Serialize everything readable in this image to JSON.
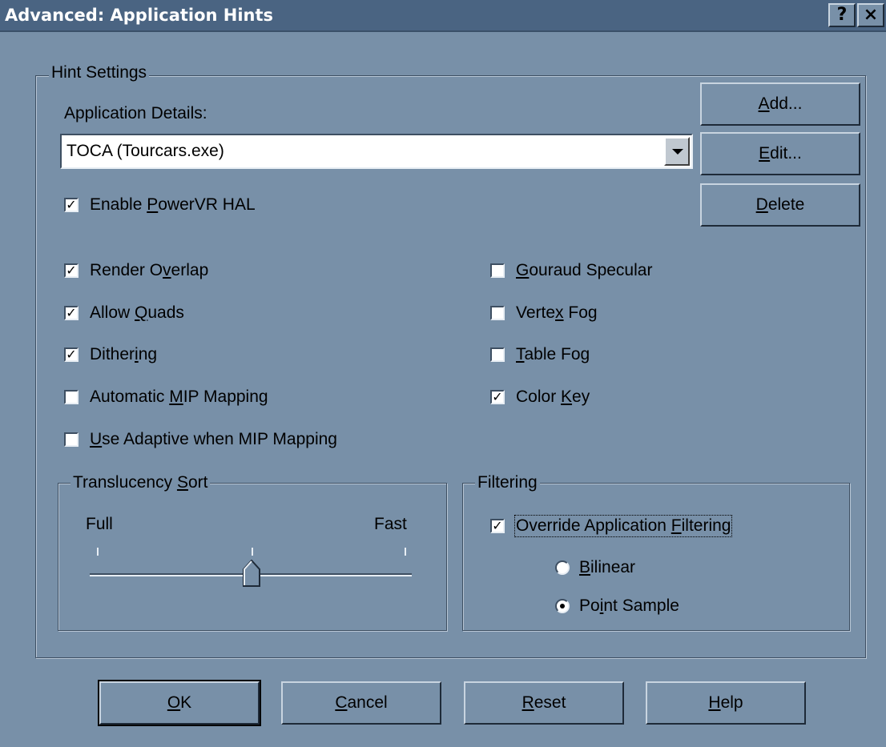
{
  "window": {
    "title": "Advanced: Application Hints",
    "help_button": "?",
    "close_button": "×"
  },
  "hint_settings": {
    "legend": "Hint Settings",
    "app_details_label": "Application Details:",
    "app_selected": "TOCA (Tourcars.exe)",
    "enable_hal": {
      "pre": "Enable ",
      "key": "P",
      "post": "owerVR HAL",
      "checked": true
    }
  },
  "side_buttons": {
    "add": {
      "key": "A",
      "rest": "dd..."
    },
    "edit": {
      "key": "E",
      "rest": "dit..."
    },
    "delete": {
      "key": "D",
      "rest": "elete"
    }
  },
  "options_left": [
    {
      "pre": "Render O",
      "key": "v",
      "post": "erlap",
      "checked": true
    },
    {
      "pre": "Allow ",
      "key": "Q",
      "post": "uads",
      "checked": true
    },
    {
      "pre": "Dither",
      "key": "i",
      "post": "ng",
      "checked": true
    },
    {
      "pre": "Automatic ",
      "key": "M",
      "post": "IP Mapping",
      "checked": false
    },
    {
      "pre": "",
      "key": "U",
      "post": "se Adaptive when MIP Mapping",
      "checked": false
    }
  ],
  "options_right": [
    {
      "pre": "",
      "key": "G",
      "post": "ouraud Specular",
      "checked": false
    },
    {
      "pre": "Verte",
      "key": "x",
      "post": " Fog",
      "checked": false
    },
    {
      "pre": "",
      "key": "T",
      "post": "able Fog",
      "checked": false
    },
    {
      "pre": "Color ",
      "key": "K",
      "post": "ey",
      "checked": true
    }
  ],
  "translucency": {
    "legend_pre": "Translucency ",
    "legend_key": "S",
    "legend_post": "ort",
    "min_label": "Full",
    "max_label": "Fast",
    "level": 0.5
  },
  "filtering": {
    "legend": "Filtering",
    "override": {
      "pre": "Override Application ",
      "key": "F",
      "post": "iltering",
      "checked": true
    },
    "bilinear": {
      "pre": "",
      "key": "B",
      "post": "ilinear",
      "selected": false
    },
    "point": {
      "pre": "Po",
      "key": "i",
      "post": "nt Sample",
      "selected": true
    }
  },
  "bottom_buttons": {
    "ok": {
      "key": "O",
      "rest": "K"
    },
    "cancel": {
      "key": "C",
      "rest": "ancel"
    },
    "reset": {
      "key": "R",
      "rest": "eset"
    },
    "help": {
      "key": "H",
      "rest": "elp"
    }
  },
  "colors": {
    "background": "#7890a8",
    "titlebar": "#4a6482"
  }
}
